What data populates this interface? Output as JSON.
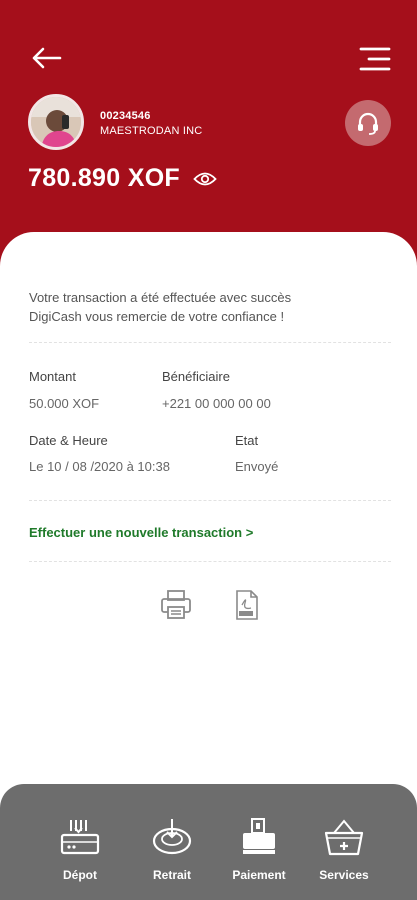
{
  "header": {
    "account_number": "00234546",
    "account_name": "MAESTRODAN INC",
    "balance": "780.890 XOF",
    "bg_color": "#a50f1b"
  },
  "icons": {
    "back": "arrow-left-icon",
    "menu": "menu-icon",
    "support": "headset-icon",
    "visibility": "eye-icon",
    "print": "printer-icon",
    "pdf": "pdf-icon"
  },
  "confirmation": {
    "line1": "Votre transaction a été effectuée avec succès",
    "line2": "DigiCash vous remercie de votre confiance !"
  },
  "details": {
    "amount_label": "Montant",
    "amount_value": "50.000 XOF",
    "beneficiary_label": "Bénéficiaire",
    "beneficiary_value": "+221 00 000 00 00",
    "datetime_label": "Date & Heure",
    "datetime_value": "Le 10 / 08 /2020 à 10:38",
    "status_label": "Etat",
    "status_value": "Envoyé"
  },
  "actions": {
    "new_transaction": "Effectuer une nouvelle transaction >"
  },
  "bottom_nav": {
    "items": [
      {
        "label": "Dépot",
        "icon": "deposit-icon"
      },
      {
        "label": "Retrait",
        "icon": "withdraw-icon"
      },
      {
        "label": "Paiement",
        "icon": "payment-icon"
      },
      {
        "label": "Services",
        "icon": "basket-icon"
      }
    ]
  }
}
